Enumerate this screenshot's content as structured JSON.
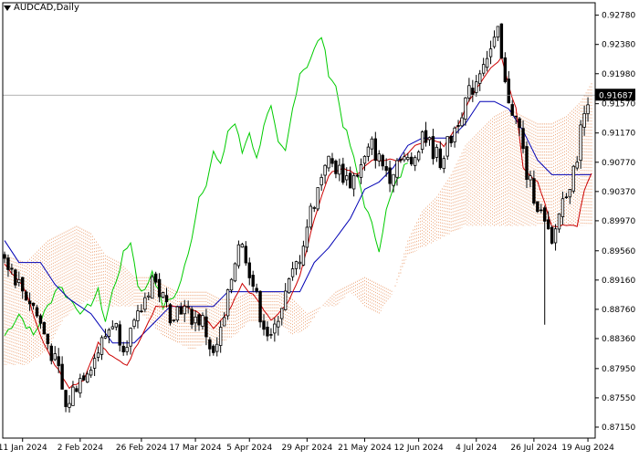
{
  "header": {
    "symbol_label": "AUDCAD,Daily"
  },
  "price_label": {
    "value": "0.91687",
    "price": 0.91687,
    "bg": "#000000",
    "fg": "#ffffff"
  },
  "colors": {
    "candle": "#000000",
    "tenkan": "#cc0000",
    "kijun": "#0000b4",
    "chikou": "#00cc00",
    "cloud": "#e8905a",
    "grid_line": "#999999",
    "axis": "#000000"
  },
  "chart_data": {
    "type": "candlestick",
    "instrument": "AUDCAD",
    "timeframe": "Daily",
    "ylim": [
      0.87,
      0.9295
    ],
    "y_ticks": [
      0.9278,
      0.9238,
      0.9198,
      0.9157,
      0.9117,
      0.9077,
      0.9037,
      0.8997,
      0.8956,
      0.8916,
      0.8876,
      0.8836,
      0.8795,
      0.8755,
      0.8715
    ],
    "x_ticks": [
      {
        "label": "11 Jan 2024",
        "index": 5
      },
      {
        "label": "2 Feb 2024",
        "index": 21
      },
      {
        "label": "26 Feb 2024",
        "index": 38
      },
      {
        "label": "17 Mar 2024",
        "index": 53
      },
      {
        "label": "5 Apr 2024",
        "index": 68
      },
      {
        "label": "29 Apr 2024",
        "index": 84
      },
      {
        "label": "21 May 2024",
        "index": 100
      },
      {
        "label": "12 Jun 2024",
        "index": 115
      },
      {
        "label": "4 Jul 2024",
        "index": 131
      },
      {
        "label": "26 Jul 2024",
        "index": 147
      },
      {
        "label": "19 Aug 2024",
        "index": 162
      }
    ],
    "anchors": [
      [
        0,
        0.895
      ],
      [
        4,
        0.891
      ],
      [
        8,
        0.888
      ],
      [
        12,
        0.883
      ],
      [
        15,
        0.879
      ],
      [
        17,
        0.874
      ],
      [
        19,
        0.8765
      ],
      [
        22,
        0.879
      ],
      [
        25,
        0.881
      ],
      [
        28,
        0.884
      ],
      [
        30,
        0.886
      ],
      [
        33,
        0.883
      ],
      [
        36,
        0.885
      ],
      [
        39,
        0.889
      ],
      [
        41,
        0.892
      ],
      [
        43,
        0.89
      ],
      [
        46,
        0.887
      ],
      [
        49,
        0.888
      ],
      [
        52,
        0.8865
      ],
      [
        55,
        0.886
      ],
      [
        58,
        0.881
      ],
      [
        61,
        0.886
      ],
      [
        63,
        0.892
      ],
      [
        65,
        0.897
      ],
      [
        67,
        0.895
      ],
      [
        69,
        0.891
      ],
      [
        71,
        0.887
      ],
      [
        74,
        0.883
      ],
      [
        76,
        0.887
      ],
      [
        79,
        0.891
      ],
      [
        82,
        0.895
      ],
      [
        85,
        0.901
      ],
      [
        87,
        0.904
      ],
      [
        89,
        0.908
      ],
      [
        92,
        0.907
      ],
      [
        96,
        0.905
      ],
      [
        99,
        0.907
      ],
      [
        102,
        0.91
      ],
      [
        104,
        0.908
      ],
      [
        107,
        0.906
      ],
      [
        110,
        0.909
      ],
      [
        113,
        0.907
      ],
      [
        116,
        0.912
      ],
      [
        118,
        0.91
      ],
      [
        121,
        0.908
      ],
      [
        124,
        0.911
      ],
      [
        127,
        0.915
      ],
      [
        129,
        0.917
      ],
      [
        131,
        0.919
      ],
      [
        133,
        0.922
      ],
      [
        135,
        0.923
      ],
      [
        137,
        0.925
      ],
      [
        139,
        0.918
      ],
      [
        141,
        0.915
      ],
      [
        143,
        0.912
      ],
      [
        145,
        0.906
      ],
      [
        148,
        0.902
      ],
      [
        150,
        0.899
      ],
      [
        152,
        0.896
      ],
      [
        154,
        0.901
      ],
      [
        156,
        0.904
      ],
      [
        158,
        0.906
      ],
      [
        160,
        0.912
      ],
      [
        162,
        0.9168
      ]
    ],
    "tenkan_sen": [
      [
        0,
        0.894
      ],
      [
        6,
        0.89
      ],
      [
        10,
        0.884
      ],
      [
        14,
        0.88
      ],
      [
        18,
        0.877
      ],
      [
        22,
        0.878
      ],
      [
        26,
        0.883
      ],
      [
        30,
        0.881
      ],
      [
        34,
        0.88
      ],
      [
        38,
        0.884
      ],
      [
        42,
        0.888
      ],
      [
        46,
        0.888
      ],
      [
        50,
        0.888
      ],
      [
        54,
        0.887
      ],
      [
        58,
        0.885
      ],
      [
        62,
        0.887
      ],
      [
        66,
        0.891
      ],
      [
        70,
        0.889
      ],
      [
        74,
        0.886
      ],
      [
        78,
        0.888
      ],
      [
        82,
        0.892
      ],
      [
        86,
        0.9
      ],
      [
        90,
        0.906
      ],
      [
        94,
        0.907
      ],
      [
        98,
        0.906
      ],
      [
        102,
        0.908
      ],
      [
        106,
        0.908
      ],
      [
        110,
        0.908
      ],
      [
        114,
        0.91
      ],
      [
        118,
        0.911
      ],
      [
        122,
        0.91
      ],
      [
        126,
        0.913
      ],
      [
        130,
        0.917
      ],
      [
        134,
        0.92
      ],
      [
        138,
        0.922
      ],
      [
        140,
        0.918
      ],
      [
        142,
        0.915
      ],
      [
        144,
        0.907
      ],
      [
        148,
        0.905
      ],
      [
        152,
        0.899
      ],
      [
        156,
        0.899
      ],
      [
        159,
        0.899
      ],
      [
        161,
        0.904
      ],
      [
        163,
        0.906
      ]
    ],
    "kijun_sen": [
      [
        0,
        0.897
      ],
      [
        4,
        0.894
      ],
      [
        10,
        0.894
      ],
      [
        14,
        0.891
      ],
      [
        18,
        0.889
      ],
      [
        24,
        0.887
      ],
      [
        30,
        0.883
      ],
      [
        36,
        0.883
      ],
      [
        42,
        0.886
      ],
      [
        46,
        0.888
      ],
      [
        52,
        0.888
      ],
      [
        58,
        0.888
      ],
      [
        62,
        0.89
      ],
      [
        66,
        0.89
      ],
      [
        72,
        0.89
      ],
      [
        78,
        0.89
      ],
      [
        82,
        0.89
      ],
      [
        86,
        0.894
      ],
      [
        90,
        0.896
      ],
      [
        96,
        0.9
      ],
      [
        100,
        0.904
      ],
      [
        104,
        0.905
      ],
      [
        108,
        0.907
      ],
      [
        112,
        0.91
      ],
      [
        116,
        0.911
      ],
      [
        120,
        0.911
      ],
      [
        124,
        0.911
      ],
      [
        128,
        0.913
      ],
      [
        132,
        0.916
      ],
      [
        136,
        0.916
      ],
      [
        140,
        0.915
      ],
      [
        144,
        0.912
      ],
      [
        148,
        0.908
      ],
      [
        152,
        0.906
      ],
      [
        156,
        0.906
      ],
      [
        160,
        0.906
      ],
      [
        163,
        0.906
      ]
    ],
    "chikou_span": [
      [
        0,
        0.884
      ],
      [
        4,
        0.887
      ],
      [
        8,
        0.884
      ],
      [
        12,
        0.888
      ],
      [
        15,
        0.891
      ],
      [
        18,
        0.889
      ],
      [
        22,
        0.887
      ],
      [
        26,
        0.89
      ],
      [
        28,
        0.886
      ],
      [
        30,
        0.89
      ],
      [
        33,
        0.895
      ],
      [
        35,
        0.897
      ],
      [
        37,
        0.891
      ],
      [
        39,
        0.89
      ],
      [
        41,
        0.893
      ],
      [
        44,
        0.888
      ],
      [
        48,
        0.89
      ],
      [
        51,
        0.895
      ],
      [
        54,
        0.903
      ],
      [
        56,
        0.905
      ],
      [
        58,
        0.909
      ],
      [
        60,
        0.907
      ],
      [
        62,
        0.912
      ],
      [
        64,
        0.913
      ],
      [
        66,
        0.909
      ],
      [
        68,
        0.912
      ],
      [
        70,
        0.908
      ],
      [
        72,
        0.913
      ],
      [
        74,
        0.915
      ],
      [
        76,
        0.91
      ],
      [
        78,
        0.909
      ],
      [
        80,
        0.915
      ],
      [
        82,
        0.92
      ],
      [
        84,
        0.921
      ],
      [
        86,
        0.923
      ],
      [
        88,
        0.925
      ],
      [
        90,
        0.92
      ],
      [
        92,
        0.918
      ],
      [
        94,
        0.913
      ],
      [
        96,
        0.91
      ],
      [
        98,
        0.906
      ],
      [
        100,
        0.902
      ],
      [
        102,
        0.899
      ],
      [
        104,
        0.896
      ],
      [
        106,
        0.901
      ],
      [
        108,
        0.904
      ],
      [
        110,
        0.906
      ],
      [
        112,
        0.908
      ]
    ],
    "senkou_a": [
      [
        0,
        0.895
      ],
      [
        6,
        0.894
      ],
      [
        12,
        0.897
      ],
      [
        16,
        0.898
      ],
      [
        20,
        0.899
      ],
      [
        24,
        0.898
      ],
      [
        28,
        0.895
      ],
      [
        32,
        0.894
      ],
      [
        36,
        0.892
      ],
      [
        40,
        0.892
      ],
      [
        44,
        0.891
      ],
      [
        48,
        0.89
      ],
      [
        52,
        0.89
      ],
      [
        56,
        0.89
      ],
      [
        60,
        0.889
      ],
      [
        64,
        0.889
      ],
      [
        68,
        0.89
      ],
      [
        72,
        0.89
      ],
      [
        76,
        0.89
      ],
      [
        80,
        0.889
      ],
      [
        84,
        0.887
      ],
      [
        88,
        0.888
      ],
      [
        92,
        0.89
      ],
      [
        96,
        0.891
      ],
      [
        100,
        0.892
      ],
      [
        104,
        0.891
      ],
      [
        108,
        0.89
      ],
      [
        112,
        0.897
      ],
      [
        116,
        0.901
      ],
      [
        120,
        0.903
      ],
      [
        124,
        0.906
      ],
      [
        128,
        0.91
      ],
      [
        132,
        0.912
      ],
      [
        136,
        0.914
      ],
      [
        140,
        0.915
      ],
      [
        144,
        0.914
      ],
      [
        148,
        0.913
      ],
      [
        152,
        0.913
      ],
      [
        156,
        0.914
      ],
      [
        160,
        0.916
      ],
      [
        163,
        0.9185
      ]
    ],
    "senkou_b": [
      [
        0,
        0.88
      ],
      [
        6,
        0.88
      ],
      [
        12,
        0.882
      ],
      [
        16,
        0.886
      ],
      [
        20,
        0.888
      ],
      [
        24,
        0.889
      ],
      [
        28,
        0.888
      ],
      [
        32,
        0.888
      ],
      [
        36,
        0.888
      ],
      [
        40,
        0.886
      ],
      [
        44,
        0.884
      ],
      [
        48,
        0.883
      ],
      [
        52,
        0.882
      ],
      [
        56,
        0.883
      ],
      [
        60,
        0.883
      ],
      [
        64,
        0.884
      ],
      [
        68,
        0.886
      ],
      [
        72,
        0.886
      ],
      [
        76,
        0.886
      ],
      [
        80,
        0.884
      ],
      [
        84,
        0.885
      ],
      [
        88,
        0.888
      ],
      [
        92,
        0.888
      ],
      [
        96,
        0.89
      ],
      [
        100,
        0.888
      ],
      [
        104,
        0.887
      ],
      [
        108,
        0.89
      ],
      [
        112,
        0.895
      ],
      [
        116,
        0.896
      ],
      [
        120,
        0.897
      ],
      [
        124,
        0.898
      ],
      [
        128,
        0.899
      ],
      [
        132,
        0.899
      ],
      [
        136,
        0.899
      ],
      [
        140,
        0.899
      ],
      [
        144,
        0.899
      ],
      [
        148,
        0.899
      ],
      [
        152,
        0.899
      ],
      [
        156,
        0.899
      ],
      [
        160,
        0.899
      ],
      [
        163,
        0.899
      ]
    ],
    "spike": {
      "index": 150,
      "low": 0.8855
    }
  }
}
